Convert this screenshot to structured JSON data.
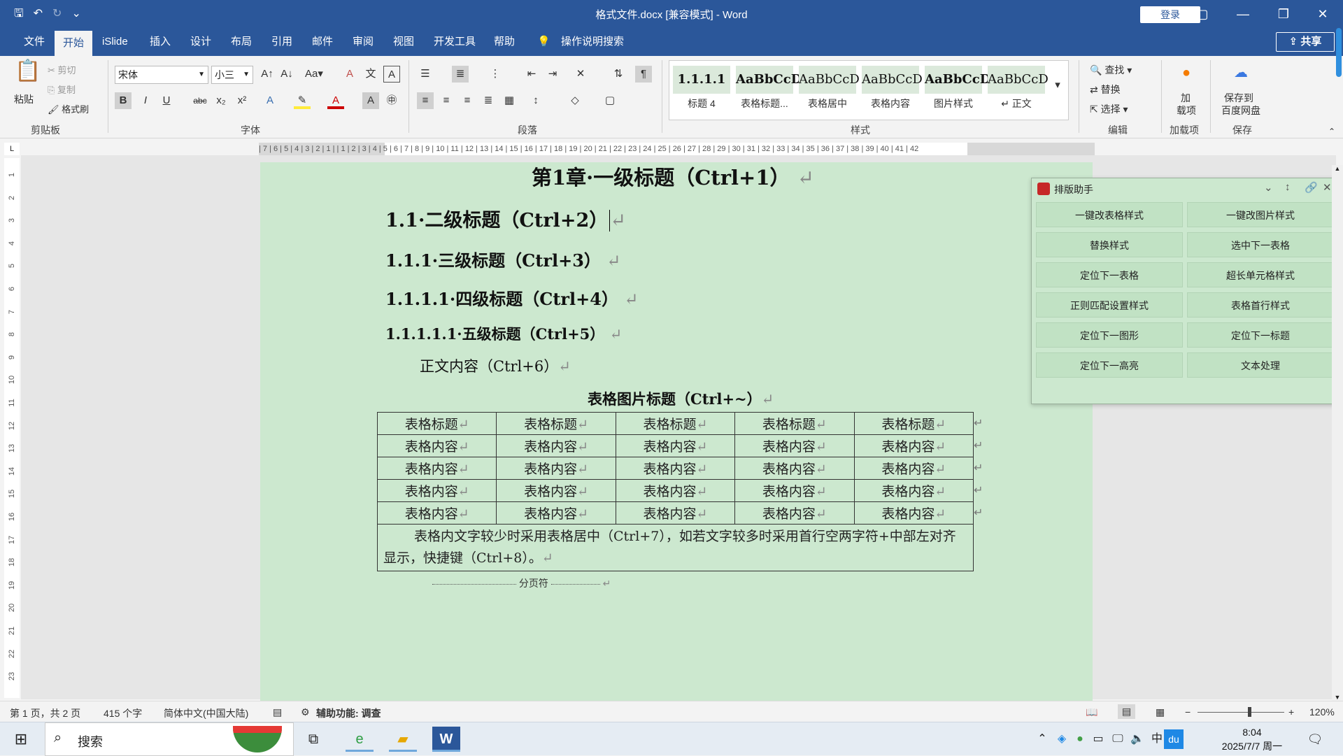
{
  "window": {
    "title": "格式文件.docx [兼容模式] - Word",
    "login": "登录",
    "qat": {
      "save": "🖫",
      "undo": "↶",
      "redo": "↻",
      "more": "⌄"
    },
    "controls": {
      "ribbon_display": "▢",
      "minimize": "—",
      "restore": "❐",
      "close": "✕"
    }
  },
  "tabs": [
    "文件",
    "开始",
    "iSlide",
    "插入",
    "设计",
    "布局",
    "引用",
    "邮件",
    "审阅",
    "视图",
    "开发工具",
    "帮助"
  ],
  "active_tab": "开始",
  "tell_me": "操作说明搜索",
  "share": "共享",
  "ribbon": {
    "clipboard": {
      "paste": "粘贴",
      "cut": "剪切",
      "copy": "复制",
      "format_painter": "格式刷",
      "label": "剪贴板"
    },
    "font": {
      "name": "宋体",
      "size": "小三",
      "label": "字体",
      "bold": "B",
      "italic": "I",
      "underline": "U",
      "strike": "abc",
      "sub": "x₂",
      "sup": "x²"
    },
    "paragraph": {
      "label": "段落"
    },
    "styles": {
      "label": "样式",
      "items": [
        {
          "sample": "1.1.1.1",
          "name": "标题 4"
        },
        {
          "sample": "AaBbCcD",
          "name": "表格标题..."
        },
        {
          "sample": "AaBbCcD",
          "name": "表格居中"
        },
        {
          "sample": "AaBbCcD",
          "name": "表格内容"
        },
        {
          "sample": "AaBbCcD",
          "name": "图片样式"
        },
        {
          "sample": "AaBbCcD",
          "name": "↵ 正文"
        }
      ]
    },
    "editing": {
      "find": "查找",
      "replace": "替换",
      "select": "选择",
      "label": "编辑"
    },
    "addins": {
      "label1": "加",
      "label2": "载项",
      "label": "加载项"
    },
    "save": {
      "l1": "保存到",
      "l2": "百度网盘",
      "label": "保存"
    }
  },
  "ruler": {
    "h": "| 7 | 6 | 5 | 4 | 3 | 2 | 1 |   | 1 | 2 | 3 | 4 | 5 | 6 | 7 | 8 | 9 | 10 | 11 | 12 | 13 | 14 | 15 | 16 | 17 | 18 | 19 | 20 | 21 | 22 | 23 | 24 | 25 | 26 | 27 | 28 | 29 | 30 | 31 | 32 | 33 | 34 | 35 | 36 | 37 | 38 | 39 | 40 | 41 | 42",
    "v": [
      "1",
      "2",
      "3",
      "4",
      "5",
      "6",
      "7",
      "8",
      "9",
      "10",
      "11",
      "12",
      "13",
      "14",
      "15",
      "16",
      "17",
      "18",
      "19",
      "20",
      "21",
      "22",
      "23"
    ]
  },
  "document": {
    "h1": "第1章·一级标题（Ctrl+1）",
    "h2": "1.1·二级标题（Ctrl+2）",
    "h3": "1.1.1·三级标题（Ctrl+3）",
    "h4": "1.1.1.1·四级标题（Ctrl+4）",
    "h5": "1.1.1.1.1·五级标题（Ctrl+5）",
    "body": "正文内容（Ctrl+6）",
    "caption": "表格图片标题（Ctrl+~）",
    "para_mark": "↵",
    "table": {
      "header": [
        "表格标题",
        "表格标题",
        "表格标题",
        "表格标题",
        "表格标题"
      ],
      "rows": [
        [
          "表格内容",
          "表格内容",
          "表格内容",
          "表格内容",
          "表格内容"
        ],
        [
          "表格内容",
          "表格内容",
          "表格内容",
          "表格内容",
          "表格内容"
        ],
        [
          "表格内容",
          "表格内容",
          "表格内容",
          "表格内容",
          "表格内容"
        ],
        [
          "表格内容",
          "表格内容",
          "表格内容",
          "表格内容",
          "表格内容"
        ]
      ],
      "note": "表格内文字较少时采用表格居中（Ctrl+7），如若文字较多时采用首行空两字符+中部左对齐显示，快捷键（Ctrl+8）。"
    },
    "page_break": "分页符"
  },
  "assistant": {
    "title": "排版助手",
    "buttons": [
      "一键改表格样式",
      "一键改图片样式",
      "替换样式",
      "选中下一表格",
      "定位下一表格",
      "超长单元格样式",
      "正则匹配设置样式",
      "表格首行样式",
      "定位下一图形",
      "定位下一标题",
      "定位下一高亮",
      "文本处理"
    ]
  },
  "status": {
    "page": "第 1 页，共 2 页",
    "words": "415 个字",
    "lang": "简体中文(中国大陆)",
    "access": "辅助功能: 调查",
    "zoom": "120%",
    "zoom_level": 0.6
  },
  "taskbar": {
    "search": "搜索",
    "time": "8:04",
    "date": "2025/7/7 周一"
  },
  "colors": {
    "brand": "#2b579a",
    "page": "#cce8cf",
    "assistant_btn": "#c1e2c4"
  }
}
